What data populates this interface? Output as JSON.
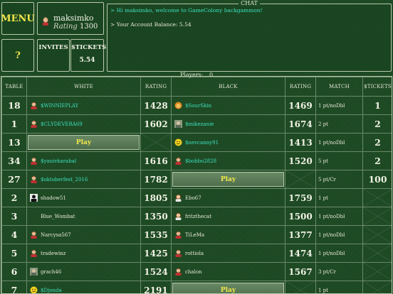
{
  "menu": {
    "menu_label": "MENU",
    "help_label": "?"
  },
  "user": {
    "name": "maksimko",
    "rating_label": "Rating",
    "rating_value": "1300"
  },
  "invites": {
    "label": "INVITES"
  },
  "tickets": {
    "label": "$TICKETS",
    "value": "5.54"
  },
  "chat": {
    "title": "CHAT",
    "messages": [
      "> Hi maksimko, welcome to GameColony backgammon!",
      "> Your Account Balance: 5.54"
    ]
  },
  "players": {
    "label": "Players:",
    "count": "0"
  },
  "table": {
    "headers": [
      "TABLE",
      "WHITE",
      "RATING",
      "BLACK",
      "RATING",
      "MATCH",
      "$TICKETS"
    ],
    "play_label": "Play",
    "rows": [
      {
        "table": "18",
        "white": "$WINNIEPLAY",
        "white_cyan": true,
        "white_rating": "1428",
        "black": "$SourSkin",
        "black_cyan": true,
        "black_rating": "1469",
        "match": "1 pt/noDbl",
        "tickets": "1"
      },
      {
        "table": "1",
        "white": "$CLYDEVERA69",
        "white_cyan": true,
        "white_rating": "1602",
        "black": "$mikezanie",
        "black_cyan": true,
        "black_rating": "1674",
        "match": "2 pt",
        "tickets": "2"
      },
      {
        "table": "13",
        "white": "",
        "white_play": true,
        "white_rating": "",
        "black": "$nevcanny91",
        "black_cyan": true,
        "black_rating": "1413",
        "match": "1 pt/noDbl",
        "tickets": "2"
      },
      {
        "table": "34",
        "white": "$yanivkarabal",
        "white_cyan": true,
        "white_rating": "1616",
        "black": "$bobbo2828",
        "black_cyan": true,
        "black_rating": "1520",
        "match": "5 pt",
        "tickets": "2"
      },
      {
        "table": "27",
        "white": "$oktoberfest_2016",
        "white_cyan": true,
        "white_rating": "1782",
        "black": "",
        "black_play": true,
        "black_rating": "",
        "match": "5 pt/Cr",
        "tickets": "100"
      },
      {
        "table": "2",
        "white": "shadow51",
        "white_cyan": false,
        "white_rating": "1805",
        "black": "Ebo67",
        "black_cyan": false,
        "black_rating": "1759",
        "match": "1 pt",
        "tickets": ""
      },
      {
        "table": "3",
        "white": "Blue_Wombat",
        "white_cyan": false,
        "white_rating": "1350",
        "black": "fritzthecat",
        "black_cyan": false,
        "black_rating": "1500",
        "match": "1 pt/noDbl",
        "tickets": ""
      },
      {
        "table": "4",
        "white": "Narcysa567",
        "white_cyan": false,
        "white_rating": "1535",
        "black": "TiLeMa",
        "black_cyan": false,
        "black_rating": "1377",
        "match": "1 pt/noDbl",
        "tickets": ""
      },
      {
        "table": "5",
        "white": "tradewinz",
        "white_cyan": false,
        "white_rating": "1425",
        "black": "rottiola",
        "black_cyan": false,
        "black_rating": "1474",
        "match": "1 pt/noDbl",
        "tickets": ""
      },
      {
        "table": "6",
        "white": "grach46",
        "white_cyan": false,
        "white_rating": "1524",
        "black": "chalon",
        "black_cyan": false,
        "black_rating": "1567",
        "match": "3 pt/Cr",
        "tickets": ""
      },
      {
        "table": "7",
        "white": "$Djonda",
        "white_cyan": true,
        "white_rating": "2191",
        "black": "",
        "black_play": true,
        "black_rating": "",
        "match": "1 pt",
        "tickets": ""
      }
    ]
  },
  "avatars": [
    "man-avatar-icon",
    "man-avatar-icon",
    "",
    "man-avatar-icon",
    "man-avatar-icon",
    "silhouette-avatar-icon",
    "",
    "man-avatar-icon",
    "man-avatar-icon",
    "photo-avatar-icon",
    "smiley-avatar-icon"
  ],
  "black_avatars": [
    "lion-avatar-icon",
    "photo-avatar-icon",
    "smiley-avatar-icon",
    "man-avatar-icon",
    "",
    "woman-avatar-icon",
    "woman-avatar-icon",
    "man-avatar-icon",
    "man-avatar-icon",
    "man-avatar-icon",
    ""
  ],
  "colors": {
    "accent_yellow": "#f2e84a",
    "cyan_name": "#3ee0c0",
    "background": "#1c4a22"
  }
}
